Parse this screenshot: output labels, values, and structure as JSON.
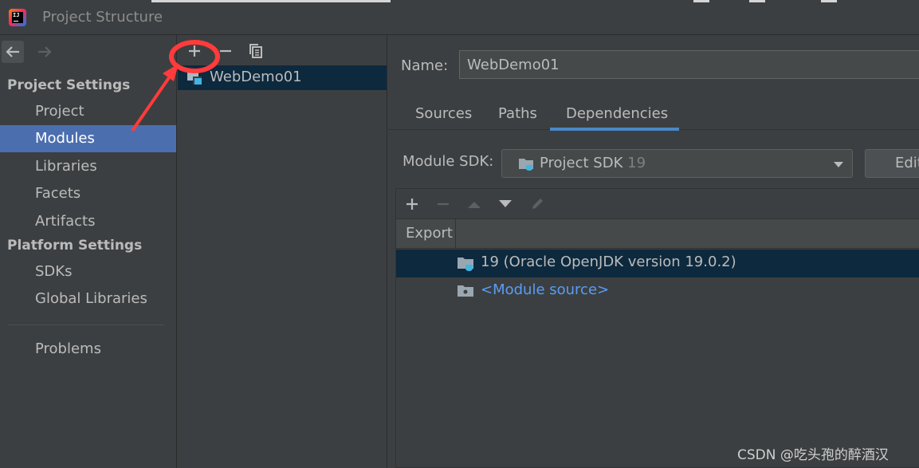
{
  "window": {
    "title": "Project Structure",
    "app_icon": "intellij-idea-icon",
    "app_icon_text": "IJ"
  },
  "nav": {
    "back_icon": "arrow-left-icon",
    "forward_icon": "arrow-right-icon"
  },
  "sidebar": {
    "project_settings_title": "Project Settings",
    "project_settings_items": [
      {
        "label": "Project"
      },
      {
        "label": "Modules",
        "selected": true
      },
      {
        "label": "Libraries"
      },
      {
        "label": "Facets"
      },
      {
        "label": "Artifacts"
      }
    ],
    "platform_settings_title": "Platform Settings",
    "platform_settings_items": [
      {
        "label": "SDKs"
      },
      {
        "label": "Global Libraries"
      }
    ],
    "problems_label": "Problems"
  },
  "modules_panel": {
    "toolbar": {
      "add_icon": "plus-icon",
      "remove_icon": "minus-icon",
      "copy_icon": "copy-icon"
    },
    "modules": [
      {
        "label": "WebDemo01",
        "selected": true
      }
    ]
  },
  "details": {
    "name_label": "Name:",
    "name_value": "WebDemo01",
    "tabs": [
      {
        "label": "Sources"
      },
      {
        "label": "Paths"
      },
      {
        "label": "Dependencies",
        "active": true
      }
    ],
    "module_sdk_label": "Module SDK:",
    "module_sdk_value": "Project SDK",
    "module_sdk_version": "19",
    "edit_label": "Edit",
    "dependencies": {
      "toolbar": [
        "plus-icon",
        "minus-icon",
        "arrow-up-icon",
        "arrow-down-icon",
        "pencil-icon"
      ],
      "column_export": "Export",
      "rows": [
        {
          "label": "19 (Oracle OpenJDK version 19.0.2)",
          "icon": "jdk-folder-icon",
          "selected": true
        },
        {
          "label": "<Module source>",
          "icon": "source-folder-icon",
          "link": true
        }
      ]
    }
  },
  "annotation": {
    "color": "#ff3b3b"
  },
  "watermark": "CSDN @吃头孢的醉酒汉",
  "colors": {
    "selection_blue": "#4b6eaf",
    "tree_selection": "#0d293e",
    "tab_underline": "#4a88c7",
    "link": "#589df6"
  }
}
